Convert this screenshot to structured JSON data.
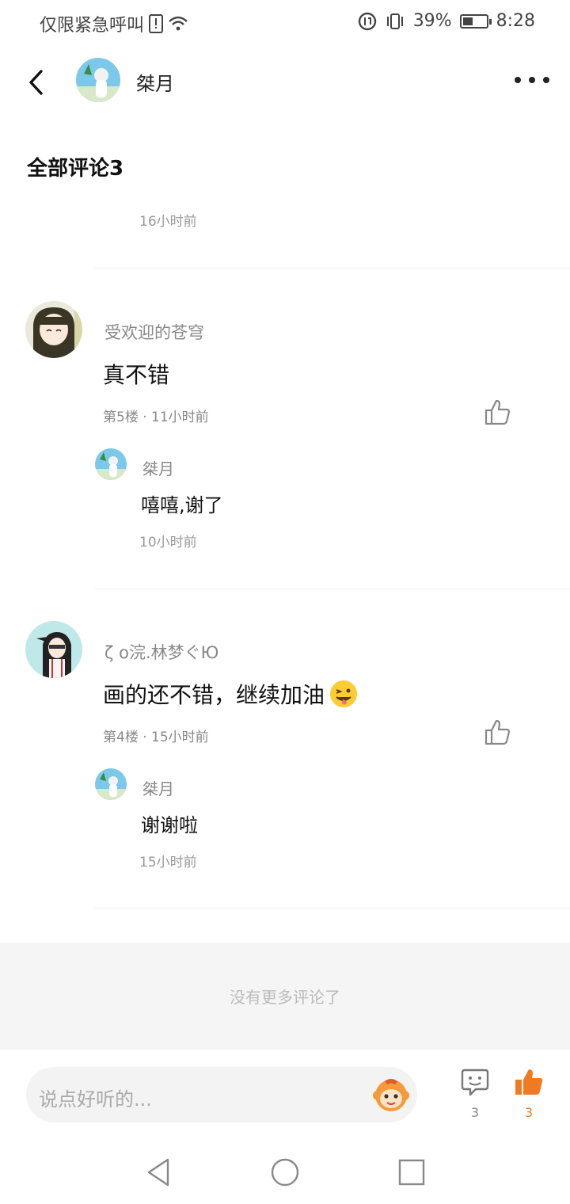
{
  "status_bar": {
    "left_text": "仅限紧急呼叫",
    "battery_percent": "39",
    "time": "8:28"
  },
  "header": {
    "username": "桀月"
  },
  "section_title": "全部评论3",
  "first_time": "16小时前",
  "comments": [
    {
      "user": "受欢迎的苍穹",
      "text": "真不错",
      "meta": "第5楼 · 11小时前",
      "reply": {
        "user": "桀月",
        "text": "嘻嘻,谢了",
        "time": "10小时前"
      }
    },
    {
      "user": "ζ ο浣.林梦ぐЮ",
      "text": "画的还不错，继续加油",
      "meta": "第4楼 · 15小时前",
      "reply": {
        "user": "桀月",
        "text": "谢谢啦",
        "time": "15小时前"
      }
    }
  ],
  "no_more": "没有更多评论了",
  "bottom": {
    "placeholder": "说点好听的...",
    "comment_count": "3",
    "like_count": "3"
  },
  "colors": {
    "accent": "#f07a22",
    "muted": "#888888",
    "background_gray": "#f5f5f5"
  }
}
